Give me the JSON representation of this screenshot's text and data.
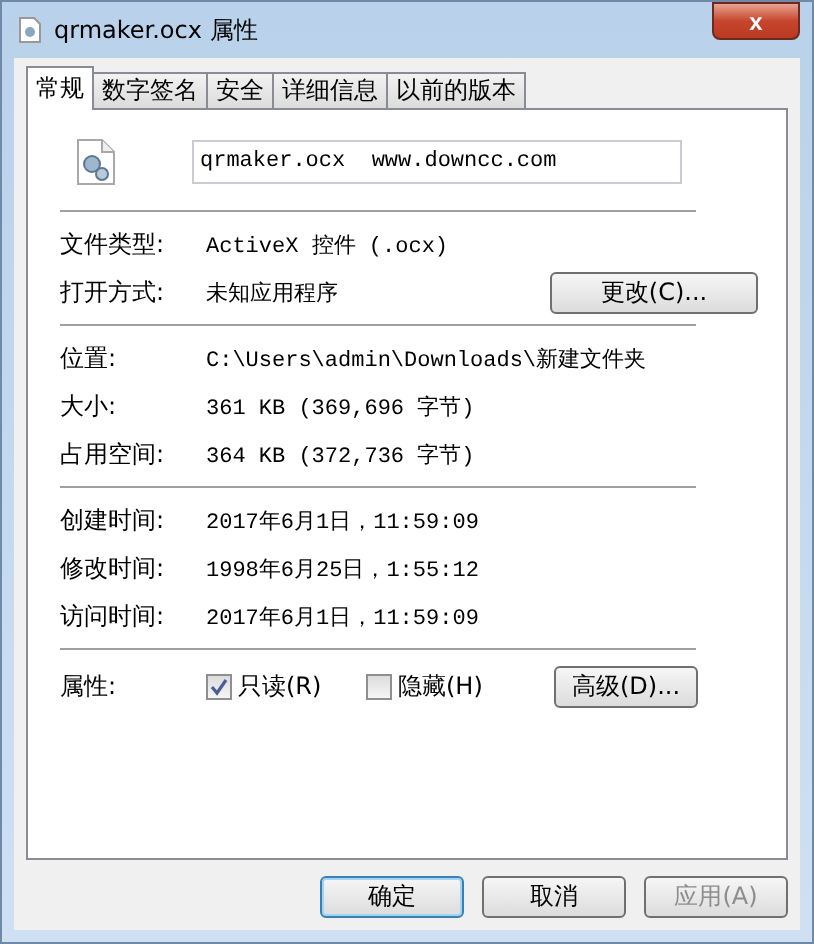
{
  "window": {
    "title": "qrmaker.ocx 属性",
    "close": "x"
  },
  "tabs": [
    {
      "label": "常规",
      "selected": true
    },
    {
      "label": "数字签名",
      "selected": false
    },
    {
      "label": "安全",
      "selected": false
    },
    {
      "label": "详细信息",
      "selected": false
    },
    {
      "label": "以前的版本",
      "selected": false
    }
  ],
  "file_name": {
    "value": "qrmaker.ocx  www.downcc.com"
  },
  "groups": [
    [
      {
        "label": "文件类型:",
        "value": "ActiveX 控件 (.ocx)"
      },
      {
        "label": "打开方式:",
        "value": "未知应用程序",
        "button": "更改(C)..."
      }
    ],
    [
      {
        "label": "位置:",
        "value": "C:\\Users\\admin\\Downloads\\新建文件夹"
      },
      {
        "label": "大小:",
        "value": "361 KB (369,696 字节)"
      },
      {
        "label": "占用空间:",
        "value": "364 KB (372,736 字节)"
      }
    ],
    [
      {
        "label": "创建时间:",
        "value": "2017年6月1日，11:59:09"
      },
      {
        "label": "修改时间:",
        "value": "1998年6月25日，1:55:12"
      },
      {
        "label": "访问时间:",
        "value": "2017年6月1日，11:59:09"
      }
    ]
  ],
  "attributes": {
    "label": "属性:",
    "options": [
      {
        "label": "只读(R)",
        "checked": true
      },
      {
        "label": "隐藏(H)",
        "checked": false
      }
    ],
    "button": "高级(D)..."
  },
  "buttons": [
    {
      "label": "确定",
      "disabled": false,
      "default": true
    },
    {
      "label": "取消",
      "disabled": false,
      "default": false
    },
    {
      "label": "应用(A)",
      "disabled": true,
      "default": false
    }
  ]
}
